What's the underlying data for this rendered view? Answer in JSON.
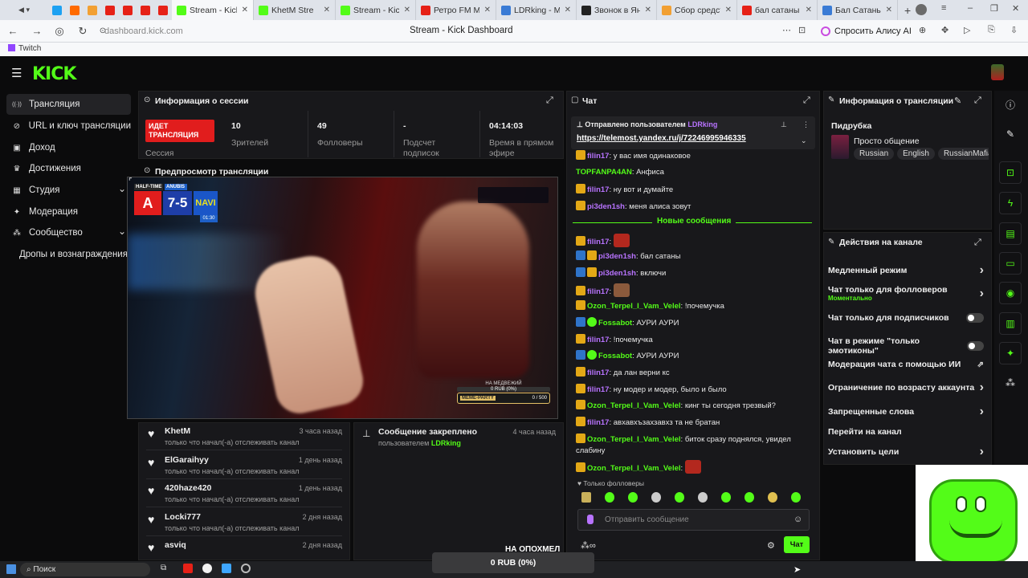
{
  "browser": {
    "tabs": [
      {
        "label": "Stream - Kick D",
        "active": true
      },
      {
        "label": "KhetM Stre",
        "active": false
      },
      {
        "label": "Stream - Kick Das",
        "active": false
      },
      {
        "label": "Ретро FM M",
        "active": false
      },
      {
        "label": "LDRking - Media",
        "active": false
      },
      {
        "label": "Звонок в Яндекс",
        "active": false
      },
      {
        "label": "Сбор средств - В",
        "active": false
      },
      {
        "label": "бал сатаны музы",
        "active": false
      },
      {
        "label": "Бал Сатаны (OST",
        "active": false
      }
    ],
    "url": "dashboard.kick.com",
    "page_title": "Stream - Kick Dashboard",
    "alice_label": "Спросить Алису AI",
    "bookmark": "Twitch"
  },
  "sidebar": {
    "items": [
      {
        "label": "Трансляция",
        "icon": "broadcast-icon",
        "active": true
      },
      {
        "label": "URL и ключ трансляции",
        "icon": "key-icon"
      },
      {
        "label": "Доход",
        "icon": "revenue-icon"
      },
      {
        "label": "Достижения",
        "icon": "trophy-icon"
      },
      {
        "label": "Студия",
        "icon": "studio-icon",
        "chevron": true
      },
      {
        "label": "Модерация",
        "icon": "wrench-icon"
      },
      {
        "label": "Сообщество",
        "icon": "community-icon",
        "chevron": true
      },
      {
        "label": "Дропы и вознаграждения",
        "icon": ""
      }
    ]
  },
  "session": {
    "title": "Информация о сессии",
    "live_badge": "ИДЕТ ТРАНСЛЯЦИЯ",
    "session_label": "Сессия",
    "stats": [
      {
        "value": "10",
        "label": "Зрителей"
      },
      {
        "value": "49",
        "label": "Фолловеры"
      },
      {
        "value": "-",
        "label": "Подсчет подписок"
      },
      {
        "value": "04:14:03",
        "label": "Время в прямом эфире"
      }
    ]
  },
  "preview": {
    "title": "Предпросмотр трансляции",
    "score_left": "7",
    "score_sep": "-",
    "score_right": "5",
    "half_time": "HALF-TIME",
    "map": "ANUBIS",
    "clock": "01:30",
    "donation_label": "НА МЕДВЕЖИЙ",
    "donation_value": "0 RUB (0%)",
    "goal_label": "МЕМЕ-PARTY",
    "goal_value": "0 / 500"
  },
  "followers": [
    {
      "name": "KhetM",
      "sub": "только что начал(-а) отслеживать канал",
      "time": "3 часа назад"
    },
    {
      "name": "ElGaraihyy",
      "sub": "только что начал(-а) отслеживать канал",
      "time": "1 день назад"
    },
    {
      "name": "420haze420",
      "sub": "только что начал(-а) отслеживать канал",
      "time": "1 день назад"
    },
    {
      "name": "Locki777",
      "sub": "только что начал(-а) отслеживать канал",
      "time": "2 дня назад"
    },
    {
      "name": "asviq",
      "sub": "",
      "time": "2 дня назад"
    }
  ],
  "pinned": {
    "title": "Сообщение закреплено",
    "by_prefix": "пользователем",
    "by_user": "LDRking",
    "time": "4 часа назад",
    "bottom_label": "НА ОПОХМЕЛ",
    "bottom_value": "0 RUB (0%)"
  },
  "chat": {
    "title": "Чат",
    "pinned_prefix": "Отправлено пользователем",
    "pinned_user": "LDRking",
    "pinned_link": "https://telemost.yandex.ru/j/72246995946335",
    "new_messages_label": "Новые сообщения",
    "messages_before": [
      {
        "user": "filin17",
        "text": "у вас имя одинаковое",
        "badges": [
          "crown"
        ],
        "color": "purple"
      },
      {
        "user": "TOPFANPA4AN",
        "text": "Анфиса",
        "badges": [],
        "color": "green"
      },
      {
        "user": "filin17",
        "text": "ну вот и думайте",
        "badges": [
          "crown"
        ],
        "color": "purple"
      },
      {
        "user": "pi3den1sh",
        "text": "меня алиса зовут",
        "badges": [
          "crown"
        ],
        "color": "purple"
      }
    ],
    "messages_after": [
      {
        "user": "filin17",
        "text": "",
        "badges": [
          "crown"
        ],
        "color": "purple",
        "emote": "red"
      },
      {
        "user": "pi3den1sh",
        "text": "бал сатаны",
        "badges": [
          "mod",
          "crown"
        ],
        "color": "purple"
      },
      {
        "user": "pi3den1sh",
        "text": "включи",
        "badges": [
          "mod",
          "crown"
        ],
        "color": "purple"
      },
      {
        "user": "filin17",
        "text": "",
        "badges": [
          "crown"
        ],
        "color": "purple",
        "emote": "face"
      },
      {
        "user": "Ozon_Terpel_I_Vam_Velel",
        "text": "!почемучка",
        "badges": [
          "crown"
        ],
        "color": "green"
      },
      {
        "user": "Fossabot",
        "text": "АУРИ АУРИ",
        "badges": [
          "mod",
          "ver"
        ],
        "color": "green"
      },
      {
        "user": "filin17",
        "text": "!почемучка",
        "badges": [
          "crown"
        ],
        "color": "purple"
      },
      {
        "user": "Fossabot",
        "text": "АУРИ АУРИ",
        "badges": [
          "mod",
          "ver"
        ],
        "color": "green"
      },
      {
        "user": "filin17",
        "text": "да лан верни кс",
        "badges": [
          "crown"
        ],
        "color": "purple"
      },
      {
        "user": "filin17",
        "text": "ну модер и модер, было и было",
        "badges": [
          "crown"
        ],
        "color": "purple"
      },
      {
        "user": "Ozon_Terpel_I_Vam_Velel",
        "text": "кинг ты сегодня трезвый?",
        "badges": [
          "crown"
        ],
        "color": "green"
      },
      {
        "user": "filin17",
        "text": "авхавхъзахзавхз та не братан",
        "badges": [
          "crown"
        ],
        "color": "purple"
      },
      {
        "user": "Ozon_Terpel_I_Vam_Velel",
        "text": "биток сразу поднялся, увидел слабину",
        "badges": [
          "crown"
        ],
        "color": "green"
      },
      {
        "user": "Ozon_Terpel_I_Vam_Velel",
        "text": "",
        "badges": [
          "crown"
        ],
        "color": "green",
        "emote": "red"
      }
    ],
    "followers_only": "Только фолловеры",
    "input_placeholder": "Отправить сообщение",
    "send_label": "Чат"
  },
  "stream_info": {
    "title": "Информация о трансляции",
    "category": "Пидрубка",
    "stream_title": "Просто общение",
    "tags": [
      "Russian",
      "English",
      "RussianMafia"
    ]
  },
  "channel_actions": {
    "title": "Действия на канале",
    "items": [
      {
        "label": "Медленный режим",
        "control": "chevron"
      },
      {
        "label": "Чат только для фолловеров",
        "sub": "Моментально",
        "control": "chevron"
      },
      {
        "label": "Чат только для подписчиков",
        "control": "toggle"
      },
      {
        "label": "Чат в режиме \"только эмотиконы\"",
        "control": "toggle"
      },
      {
        "label": "Модерация чата с помощью ИИ",
        "control": "external"
      },
      {
        "label": "Ограничение по возрасту аккаунта",
        "control": "chevron"
      },
      {
        "label": "Запрещенные слова",
        "control": "chevron"
      },
      {
        "label": "Перейти на канал",
        "control": "none"
      },
      {
        "label": "Установить цели",
        "control": "chevron"
      }
    ]
  },
  "taskbar": {
    "search_label": "Поиск",
    "footer_value": "0 RUB (0%)"
  },
  "colors": {
    "kick_green": "#53fc18",
    "panel_bg": "#18181b",
    "live_red": "#e11d1d",
    "username_purple": "#b873ff"
  }
}
